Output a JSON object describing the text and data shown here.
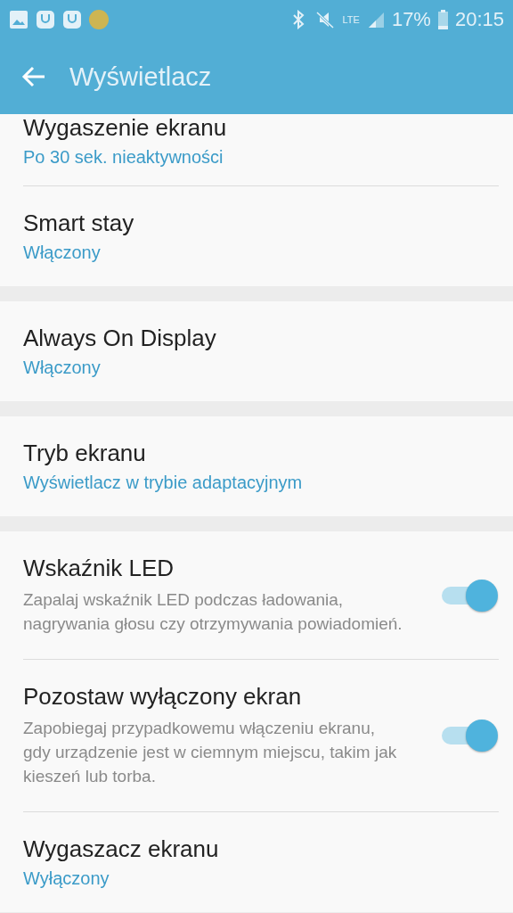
{
  "status_bar": {
    "network": "LTE",
    "battery": "17%",
    "time": "20:15"
  },
  "app_bar": {
    "title": "Wyświetlacz"
  },
  "groups": [
    {
      "items": [
        {
          "kind": "value",
          "title": "Wygaszenie ekranu",
          "value": "Po 30 sek. nieaktywności"
        },
        {
          "kind": "value",
          "title": "Smart stay",
          "value": "Włączony"
        }
      ]
    },
    {
      "items": [
        {
          "kind": "value",
          "title": "Always On Display",
          "value": "Włączony"
        }
      ]
    },
    {
      "items": [
        {
          "kind": "value",
          "title": "Tryb ekranu",
          "value": "Wyświetlacz w trybie adaptacyjnym"
        }
      ]
    },
    {
      "items": [
        {
          "kind": "toggle",
          "title": "Wskaźnik LED",
          "description": "Zapalaj wskaźnik LED podczas ładowania, nagrywania głosu czy otrzymywania powiadomień.",
          "on": true
        },
        {
          "kind": "toggle",
          "title": "Pozostaw wyłączony ekran",
          "description": "Zapobiegaj przypadkowemu włączeniu ekranu, gdy urządzenie jest w ciemnym miejscu, takim jak kieszeń lub torba.",
          "on": true
        },
        {
          "kind": "value",
          "title": "Wygaszacz ekranu",
          "value": "Wyłączony"
        }
      ]
    }
  ]
}
